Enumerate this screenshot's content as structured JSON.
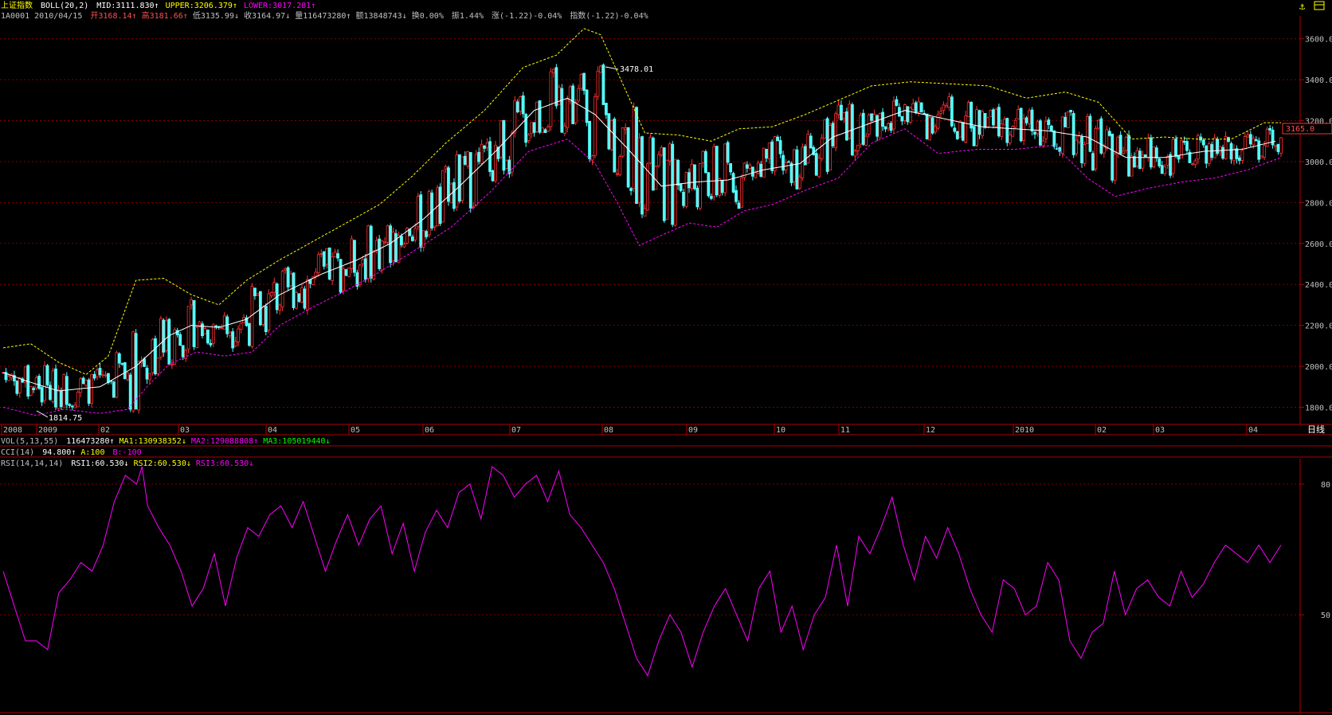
{
  "header": {
    "index_name": "上证指数",
    "boll_label": "BOLL(20,2)",
    "mid": "MID:3111.830",
    "upper": "UPPER:3206.379",
    "lower": "LOWER:3017.281",
    "code_date": "1A0001 2010/04/15",
    "open": "开3168.14",
    "high": "高3181.66",
    "low": "低3135.99",
    "close": "收3164.97",
    "volume": "量116473280",
    "amount": "额13848743",
    "turnover": "换0.00%",
    "amplitude": "振1.44%",
    "change": "涨(-1.22)-0.04%",
    "index_change": "指数(-1.22)-0.04%"
  },
  "vol_line": {
    "label": "VOL(5,13,55)",
    "vol": "116473280",
    "ma1": "MA1:130938352",
    "ma2": "MA2:129088808",
    "ma3": "MA3:105019440"
  },
  "cci_line": {
    "label": "CCI(14)",
    "value": "94.800",
    "a": "A:100",
    "b": "B:-100"
  },
  "rsi_line": {
    "label": "RSI(14,14,14)",
    "rsi1": "RSI1:60.530",
    "rsi2": "RSI2:60.530",
    "rsi3": "RSI3:60.530"
  },
  "right_labels": {
    "period": "日线",
    "last_price": "3165.0"
  },
  "annotations": {
    "peak": "3478.01",
    "trough": "1814.75"
  },
  "colors": {
    "up": "#ff3030",
    "down": "#54ffff",
    "mid": "#ffffff",
    "upper": "#ffff00",
    "lower": "#ff00ff",
    "grid": "#800000",
    "rsi": "#ff00ff",
    "axis": "#b00000"
  },
  "chart_data": [
    {
      "type": "candlestick",
      "title": "上证指数 BOLL(20,2)",
      "ylim": [
        1750,
        3700
      ],
      "yticks": [
        1800,
        2000,
        2200,
        2400,
        2600,
        2800,
        3000,
        3200,
        3400,
        3600
      ],
      "xticks": [
        "2008",
        "2009",
        "02",
        "03",
        "04",
        "05",
        "06",
        "07",
        "08",
        "09",
        "10",
        "11",
        "12",
        "2010",
        "02",
        "03",
        "04"
      ],
      "series": [
        {
          "name": "MID",
          "points": [
            [
              0,
              1970
            ],
            [
              8,
              1930
            ],
            [
              20,
              1880
            ],
            [
              35,
              1900
            ],
            [
              48,
              2000
            ],
            [
              60,
              2150
            ],
            [
              68,
              2200
            ],
            [
              78,
              2190
            ],
            [
              88,
              2230
            ],
            [
              100,
              2350
            ],
            [
              115,
              2450
            ],
            [
              128,
              2520
            ],
            [
              140,
              2600
            ],
            [
              152,
              2720
            ],
            [
              165,
              2880
            ],
            [
              178,
              3050
            ],
            [
              192,
              3250
            ],
            [
              204,
              3310
            ],
            [
              214,
              3230
            ],
            [
              226,
              3060
            ],
            [
              238,
              2880
            ],
            [
              250,
              2900
            ],
            [
              262,
              2910
            ],
            [
              275,
              2960
            ],
            [
              288,
              2990
            ],
            [
              300,
              3120
            ],
            [
              312,
              3180
            ],
            [
              326,
              3250
            ],
            [
              340,
              3210
            ],
            [
              354,
              3170
            ],
            [
              366,
              3160
            ],
            [
              378,
              3150
            ],
            [
              392,
              3120
            ],
            [
              406,
              3020
            ],
            [
              420,
              3020
            ],
            [
              434,
              3050
            ],
            [
              448,
              3060
            ],
            [
              460,
              3100
            ]
          ]
        },
        {
          "name": "UPPER",
          "points": [
            [
              0,
              2090
            ],
            [
              10,
              2110
            ],
            [
              20,
              2020
            ],
            [
              30,
              1960
            ],
            [
              38,
              2050
            ],
            [
              48,
              2420
            ],
            [
              58,
              2430
            ],
            [
              68,
              2350
            ],
            [
              78,
              2300
            ],
            [
              88,
              2420
            ],
            [
              100,
              2520
            ],
            [
              112,
              2610
            ],
            [
              124,
              2700
            ],
            [
              136,
              2790
            ],
            [
              148,
              2930
            ],
            [
              160,
              3090
            ],
            [
              174,
              3250
            ],
            [
              188,
              3460
            ],
            [
              200,
              3520
            ],
            [
              210,
              3650
            ],
            [
              216,
              3620
            ],
            [
              224,
              3380
            ],
            [
              232,
              3140
            ],
            [
              244,
              3130
            ],
            [
              256,
              3100
            ],
            [
              266,
              3160
            ],
            [
              278,
              3170
            ],
            [
              290,
              3230
            ],
            [
              302,
              3300
            ],
            [
              314,
              3370
            ],
            [
              328,
              3390
            ],
            [
              342,
              3380
            ],
            [
              356,
              3370
            ],
            [
              370,
              3310
            ],
            [
              384,
              3340
            ],
            [
              396,
              3290
            ],
            [
              408,
              3110
            ],
            [
              420,
              3120
            ],
            [
              432,
              3110
            ],
            [
              444,
              3110
            ],
            [
              456,
              3190
            ],
            [
              462,
              3190
            ]
          ]
        },
        {
          "name": "LOWER",
          "points": [
            [
              0,
              1800
            ],
            [
              12,
              1760
            ],
            [
              22,
              1790
            ],
            [
              35,
              1770
            ],
            [
              45,
              1790
            ],
            [
              52,
              1900
            ],
            [
              60,
              2010
            ],
            [
              70,
              2070
            ],
            [
              80,
              2050
            ],
            [
              90,
              2070
            ],
            [
              100,
              2200
            ],
            [
              112,
              2290
            ],
            [
              124,
              2370
            ],
            [
              136,
              2460
            ],
            [
              148,
              2560
            ],
            [
              162,
              2680
            ],
            [
              176,
              2850
            ],
            [
              190,
              3050
            ],
            [
              204,
              3110
            ],
            [
              214,
              2990
            ],
            [
              222,
              2800
            ],
            [
              230,
              2590
            ],
            [
              238,
              2640
            ],
            [
              248,
              2700
            ],
            [
              258,
              2680
            ],
            [
              268,
              2760
            ],
            [
              278,
              2790
            ],
            [
              290,
              2860
            ],
            [
              302,
              2920
            ],
            [
              314,
              3090
            ],
            [
              326,
              3160
            ],
            [
              338,
              3040
            ],
            [
              352,
              3060
            ],
            [
              366,
              3060
            ],
            [
              380,
              3080
            ],
            [
              392,
              2920
            ],
            [
              402,
              2830
            ],
            [
              414,
              2870
            ],
            [
              426,
              2900
            ],
            [
              438,
              2920
            ],
            [
              450,
              2960
            ],
            [
              462,
              3020
            ]
          ]
        }
      ]
    },
    {
      "type": "line",
      "title": "RSI(14,14,14)",
      "ylim": [
        36,
        85
      ],
      "yticks": [
        50,
        80
      ],
      "series": [
        {
          "name": "RSI1",
          "points": [
            [
              0,
              60
            ],
            [
              4,
              52
            ],
            [
              8,
              44
            ],
            [
              12,
              44
            ],
            [
              16,
              42
            ],
            [
              20,
              55
            ],
            [
              24,
              58
            ],
            [
              28,
              62
            ],
            [
              32,
              60
            ],
            [
              36,
              66
            ],
            [
              40,
              76
            ],
            [
              44,
              82
            ],
            [
              48,
              80
            ],
            [
              50,
              84
            ],
            [
              52,
              75
            ],
            [
              56,
              70
            ],
            [
              60,
              66
            ],
            [
              64,
              60
            ],
            [
              68,
              52
            ],
            [
              72,
              56
            ],
            [
              76,
              64
            ],
            [
              80,
              52
            ],
            [
              84,
              63
            ],
            [
              88,
              70
            ],
            [
              92,
              68
            ],
            [
              96,
              73
            ],
            [
              100,
              75
            ],
            [
              104,
              70
            ],
            [
              108,
              76
            ],
            [
              112,
              68
            ],
            [
              116,
              60
            ],
            [
              120,
              67
            ],
            [
              124,
              73
            ],
            [
              128,
              66
            ],
            [
              132,
              72
            ],
            [
              136,
              75
            ],
            [
              140,
              64
            ],
            [
              144,
              71
            ],
            [
              148,
              60
            ],
            [
              152,
              69
            ],
            [
              156,
              74
            ],
            [
              160,
              70
            ],
            [
              164,
              78
            ],
            [
              168,
              80
            ],
            [
              172,
              72
            ],
            [
              176,
              84
            ],
            [
              180,
              82
            ],
            [
              184,
              77
            ],
            [
              188,
              80
            ],
            [
              192,
              82
            ],
            [
              196,
              76
            ],
            [
              200,
              83
            ],
            [
              204,
              73
            ],
            [
              208,
              70
            ],
            [
              212,
              66
            ],
            [
              216,
              62
            ],
            [
              220,
              56
            ],
            [
              224,
              48
            ],
            [
              228,
              40
            ],
            [
              232,
              36
            ],
            [
              236,
              44
            ],
            [
              240,
              50
            ],
            [
              244,
              46
            ],
            [
              248,
              38
            ],
            [
              252,
              46
            ],
            [
              256,
              52
            ],
            [
              260,
              56
            ],
            [
              264,
              50
            ],
            [
              268,
              44
            ],
            [
              272,
              56
            ],
            [
              276,
              60
            ],
            [
              280,
              46
            ],
            [
              284,
              52
            ],
            [
              288,
              42
            ],
            [
              292,
              50
            ],
            [
              296,
              54
            ],
            [
              300,
              66
            ],
            [
              304,
              52
            ],
            [
              308,
              68
            ],
            [
              312,
              64
            ],
            [
              316,
              70
            ],
            [
              320,
              77
            ],
            [
              324,
              66
            ],
            [
              328,
              58
            ],
            [
              332,
              68
            ],
            [
              336,
              63
            ],
            [
              340,
              70
            ],
            [
              344,
              64
            ],
            [
              348,
              56
            ],
            [
              352,
              50
            ],
            [
              356,
              46
            ],
            [
              360,
              58
            ],
            [
              364,
              56
            ],
            [
              368,
              50
            ],
            [
              372,
              52
            ],
            [
              376,
              62
            ],
            [
              380,
              58
            ],
            [
              384,
              44
            ],
            [
              388,
              40
            ],
            [
              392,
              46
            ],
            [
              396,
              48
            ],
            [
              400,
              60
            ],
            [
              404,
              50
            ],
            [
              408,
              56
            ],
            [
              412,
              58
            ],
            [
              416,
              54
            ],
            [
              420,
              52
            ],
            [
              424,
              60
            ],
            [
              428,
              54
            ],
            [
              432,
              57
            ],
            [
              436,
              62
            ],
            [
              440,
              66
            ],
            [
              444,
              64
            ],
            [
              448,
              62
            ],
            [
              452,
              66
            ],
            [
              456,
              62
            ],
            [
              460,
              66
            ]
          ]
        }
      ]
    }
  ]
}
